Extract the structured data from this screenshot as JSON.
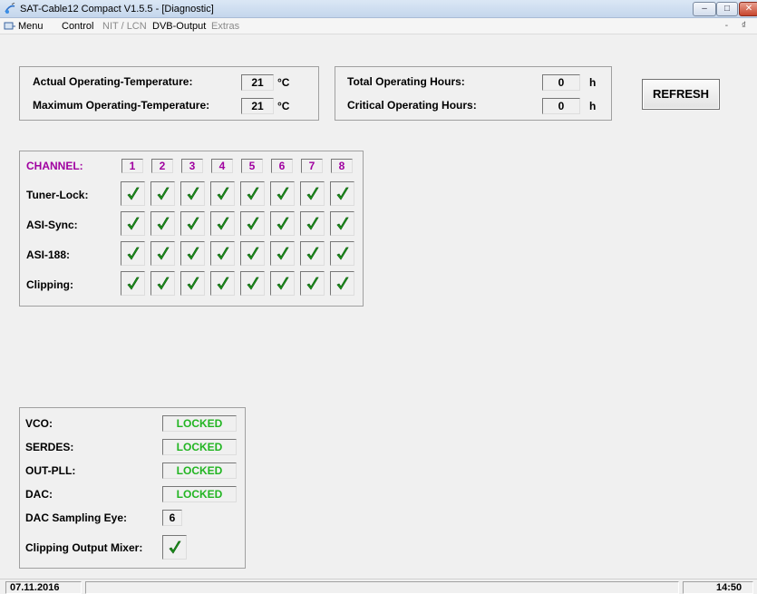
{
  "window": {
    "title": "SAT-Cable12 Compact V1.5.5 - [Diagnostic]",
    "controls": [
      "–",
      "□",
      "✕"
    ]
  },
  "menu": {
    "items": [
      "Menu",
      "Control",
      "NIT / LCN",
      "DVB-Output",
      "Extras"
    ],
    "mdi_controls": "- ₫"
  },
  "temperature": {
    "actual_label": "Actual Operating-Temperature:",
    "actual_value": "21",
    "max_label": "Maximum Operating-Temperature:",
    "max_value": "21",
    "unit": "°C"
  },
  "hours": {
    "total_label": "Total Operating Hours:",
    "total_value": "0",
    "critical_label": "Critical Operating Hours:",
    "critical_value": "0",
    "unit": "h"
  },
  "refresh_label": "REFRESH",
  "channels": {
    "header_label": "CHANNEL:",
    "numbers": [
      "1",
      "2",
      "3",
      "4",
      "5",
      "6",
      "7",
      "8"
    ],
    "rows": [
      {
        "label": "Tuner-Lock:",
        "checked": [
          true,
          true,
          true,
          true,
          true,
          true,
          true,
          true
        ]
      },
      {
        "label": "ASI-Sync:",
        "checked": [
          true,
          true,
          true,
          true,
          true,
          true,
          true,
          true
        ]
      },
      {
        "label": "ASI-188:",
        "checked": [
          true,
          true,
          true,
          true,
          true,
          true,
          true,
          true
        ]
      },
      {
        "label": "Clipping:",
        "checked": [
          true,
          true,
          true,
          true,
          true,
          true,
          true,
          true
        ]
      }
    ]
  },
  "status": {
    "vco_label": "VCO:",
    "vco_value": "LOCKED",
    "serdes_label": "SERDES:",
    "serdes_value": "LOCKED",
    "outpll_label": "OUT-PLL:",
    "outpll_value": "LOCKED",
    "dac_label": "DAC:",
    "dac_value": "LOCKED",
    "eye_label": "DAC Sampling Eye:",
    "eye_value": "6",
    "clip_mixer_label": "Clipping Output Mixer:",
    "clip_mixer_checked": true
  },
  "statusbar": {
    "date": "07.11.2016",
    "time": "14:50"
  },
  "colors": {
    "channel_purple": "#a000a0",
    "locked_green": "#22b522",
    "check_green": "#1f9a1f"
  }
}
